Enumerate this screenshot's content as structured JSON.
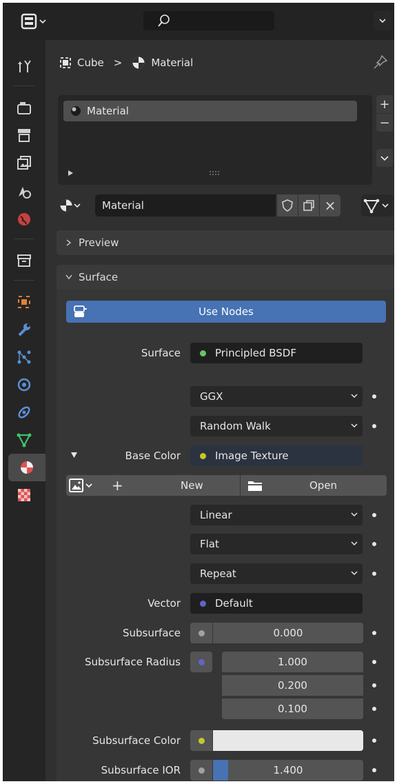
{
  "header": {
    "editor_icon": "properties-editor-icon",
    "search_icon": "search-icon",
    "search_value": "",
    "options_icon": "chevron-down-icon"
  },
  "tabs": [
    {
      "name": "tool",
      "icon": "tool-icon"
    },
    {
      "name": "render",
      "icon": "render-icon"
    },
    {
      "name": "output",
      "icon": "output-icon"
    },
    {
      "name": "view-layer",
      "icon": "view-layer-icon"
    },
    {
      "name": "scene",
      "icon": "scene-icon"
    },
    {
      "name": "world",
      "icon": "world-icon"
    },
    {
      "name": "collection",
      "icon": "collection-icon"
    },
    {
      "name": "object",
      "icon": "object-icon"
    },
    {
      "name": "modifiers",
      "icon": "wrench-icon"
    },
    {
      "name": "particles",
      "icon": "particles-icon"
    },
    {
      "name": "physics",
      "icon": "physics-icon"
    },
    {
      "name": "constraints",
      "icon": "constraints-icon"
    },
    {
      "name": "data",
      "icon": "mesh-data-icon"
    },
    {
      "name": "material",
      "icon": "material-icon",
      "active": true
    },
    {
      "name": "texture",
      "icon": "texture-icon"
    }
  ],
  "breadcrumb": {
    "object": "Cube",
    "separator": ">",
    "material": "Material"
  },
  "slots": {
    "items": [
      "Material"
    ],
    "add": "+",
    "remove": "−"
  },
  "material_selector": {
    "name": "Material",
    "close": "×"
  },
  "panels": {
    "preview": {
      "label": "Preview",
      "collapsed": true
    },
    "surface": {
      "label": "Surface",
      "collapsed": false
    }
  },
  "use_nodes": "Use Nodes",
  "surface": {
    "surface_label": "Surface",
    "surface_value": "Principled BSDF",
    "distribution": "GGX",
    "subsurface_method": "Random Walk",
    "base_color_label": "Base Color",
    "base_color_value": "Image Texture",
    "image_new": "New",
    "image_open": "Open",
    "new_prefix": "+",
    "interpolation": "Linear",
    "projection": "Flat",
    "extension": "Repeat",
    "vector_label": "Vector",
    "vector_value": "Default",
    "subsurface_label": "Subsurface",
    "subsurface_value": "0.000",
    "radius_label": "Subsurface Radius",
    "radius_values": [
      "1.000",
      "0.200",
      "0.100"
    ],
    "sss_color_label": "Subsurface Color",
    "sss_color": "#e8e8e8",
    "sss_ior_label": "Subsurface IOR",
    "sss_ior_value": "1.400",
    "sss_ior_fill": 0.1
  },
  "colors": {
    "accent": "#4772b3",
    "green_socket": "#63c763",
    "yellow_socket": "#c7c729",
    "blue_socket": "#6363c7",
    "grey_socket": "#a1a1a1"
  }
}
